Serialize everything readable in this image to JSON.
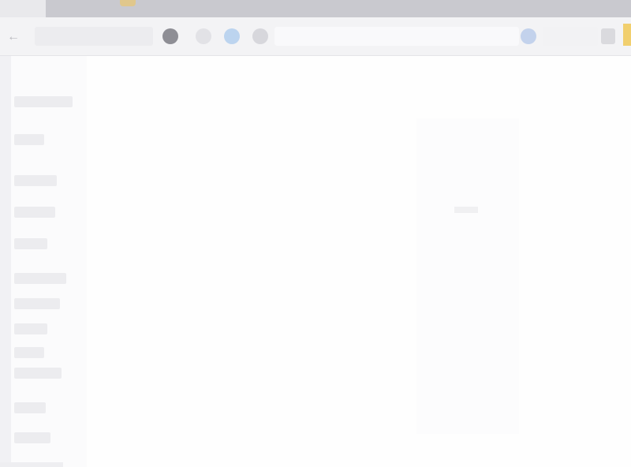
{
  "window": {
    "title": ""
  },
  "toolbar": {
    "back_icon": "back-arrow-icon",
    "address": "",
    "buttons": [
      "stop-icon",
      "home-icon",
      "bookmark-icon",
      "reload-icon"
    ]
  },
  "sidebar": {
    "items": [
      {},
      {},
      {},
      {},
      {},
      {},
      {},
      {},
      {},
      {},
      {},
      {}
    ]
  },
  "colors": {
    "tabstrip": "#c9c9cf",
    "toolbar": "#f3f3f5",
    "accent_yellow": "#f1cf6e",
    "accent_blue": "#bcd4ef"
  }
}
